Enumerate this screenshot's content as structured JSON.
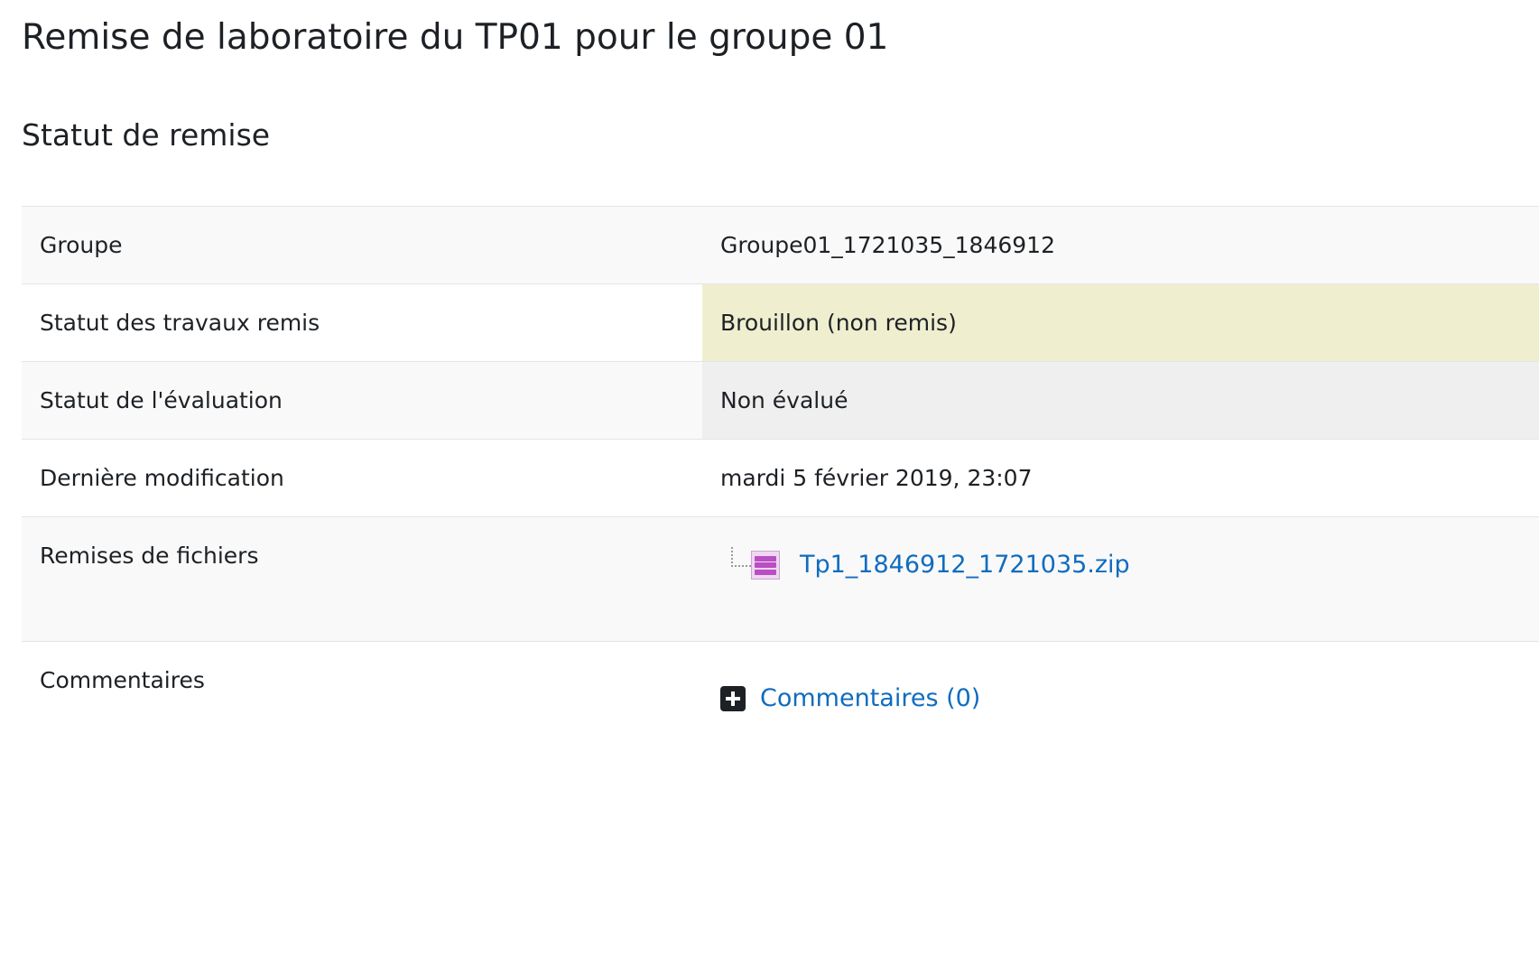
{
  "page": {
    "title": "Remise de laboratoire du TP01 pour le groupe 01"
  },
  "submission_status": {
    "heading": "Statut de remise",
    "rows": [
      {
        "label": "Groupe",
        "value": "Groupe01_1721035_1846912"
      },
      {
        "label": "Statut des travaux remis",
        "value": "Brouillon (non remis)"
      },
      {
        "label": "Statut de l'évaluation",
        "value": "Non évalué"
      },
      {
        "label": "Dernière modification",
        "value": "mardi 5 février 2019, 23:07"
      },
      {
        "label": "Remises de fichiers",
        "file": {
          "name": "Tp1_1846912_1721035.zip",
          "icon": "zip-file-icon"
        }
      },
      {
        "label": "Commentaires",
        "link": "Commentaires (0)",
        "icon": "plus-square-icon"
      }
    ]
  },
  "colors": {
    "draft_status_bg": "#efeecf",
    "not_graded_bg": "#efefef",
    "link": "#0f6cbf"
  }
}
